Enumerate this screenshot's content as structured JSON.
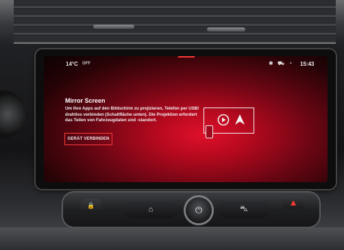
{
  "status": {
    "temperature": "14°C",
    "climate_state": "OFF",
    "time": "15:43",
    "icons": [
      "bluetooth-icon",
      "car-connection-icon",
      "signal-icon"
    ]
  },
  "mirror_screen": {
    "title": "Mirror Screen",
    "description": "Um Ihre Apps auf den Bildschirm zu projizieren, Telefon per USB/ drahtlos verbinden (Schaltfläche unten). Die Projektion erfordert das Teilen von Fahrzeugdaten und -standort.",
    "connect_button": "GERÄT VERBINDEN",
    "illustration_icons": [
      "android-auto-icon",
      "carplay-icon",
      "phone-icon"
    ]
  },
  "console": {
    "buttons": [
      "lock-icon",
      "home-icon",
      "power-icon",
      "car-icon",
      "hazard-icon"
    ]
  },
  "colors": {
    "accent": "#e0102a",
    "highlight_border": "#ff3b3b",
    "text": "#ffffff"
  }
}
